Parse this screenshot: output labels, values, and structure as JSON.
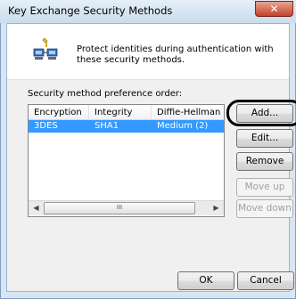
{
  "window": {
    "title": "Key Exchange Security Methods",
    "close_glyph": "✕"
  },
  "header": {
    "icon": "key-exchange-computers-icon",
    "description": "Protect identities during authentication with these security methods."
  },
  "list": {
    "label": "Security method preference order:",
    "columns": [
      "Encryption",
      "Integrity",
      "Diffie-Hellman ..."
    ],
    "rows": [
      {
        "encryption": "3DES",
        "integrity": "SHA1",
        "diffie_hellman": "Medium (2)",
        "selected": true
      }
    ],
    "scrollbar": {
      "left_arrow": "◀",
      "right_arrow": "▶",
      "thumb_grip": "III"
    }
  },
  "buttons": {
    "add": "Add...",
    "edit": "Edit...",
    "remove": "Remove",
    "move_up": "Move up",
    "move_down": "Move down",
    "ok": "OK",
    "cancel": "Cancel"
  },
  "colors": {
    "selection": "#3399ff",
    "frame": "#d8e6f3",
    "close_button": "#c4402a"
  }
}
